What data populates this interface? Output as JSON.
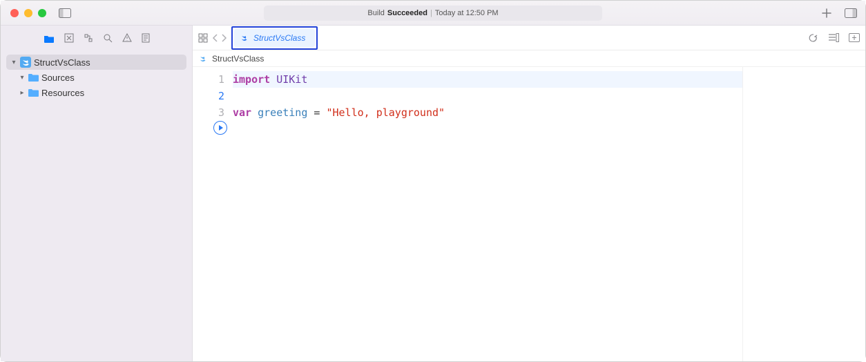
{
  "titlebar": {
    "status_prefix": "Build",
    "status_bold": "Succeeded",
    "status_suffix": "Today at 12:50 PM"
  },
  "sidebar": {
    "project_name": "StructVsClass",
    "folders": [
      {
        "name": "Sources",
        "expanded": true
      },
      {
        "name": "Resources",
        "expanded": false
      }
    ]
  },
  "jumpbar": {
    "active_tab": "StructVsClass"
  },
  "breadcrumb": {
    "file": "StructVsClass"
  },
  "editor": {
    "lines": [
      "1",
      "2",
      "3"
    ],
    "current_line_index": 1,
    "code": {
      "line1_kw": "import",
      "line1_mod": "UIKit",
      "line3_kw": "var",
      "line3_name": "greeting",
      "line3_eq": " = ",
      "line3_str": "\"Hello, playground\""
    }
  }
}
